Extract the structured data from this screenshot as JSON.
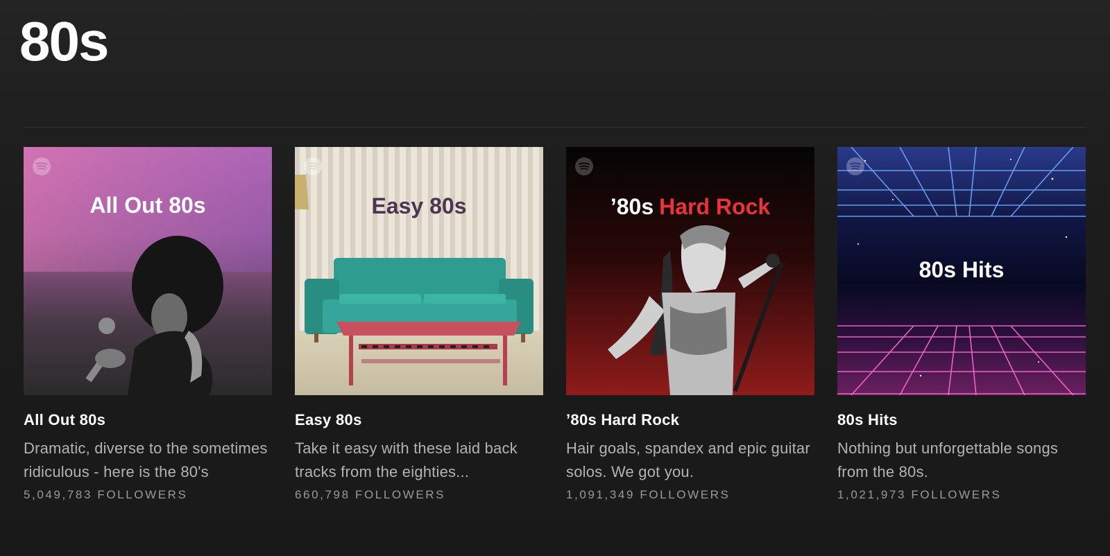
{
  "page": {
    "title": "80s"
  },
  "playlists": [
    {
      "cover_text": "All Out 80s",
      "title": "All Out 80s",
      "description": "Dramatic, diverse to the sometimes ridiculous - here is the 80's",
      "followers": "5,049,783 FOLLOWERS"
    },
    {
      "cover_text": "Easy 80s",
      "title": "Easy 80s",
      "description": "Take it easy with these laid back tracks from the eighties...",
      "followers": "660,798 FOLLOWERS"
    },
    {
      "cover_text_white": "’80s",
      "cover_text_red": "Hard Rock",
      "title": "’80s Hard Rock",
      "description": "Hair goals, spandex and epic guitar solos. We got you.",
      "followers": "1,091,349 FOLLOWERS"
    },
    {
      "cover_text": "80s Hits",
      "title": "80s Hits",
      "description": "Nothing but unforgettable songs from the 80s.",
      "followers": "1,021,973 FOLLOWERS"
    }
  ],
  "colors": {
    "background": "#1b1b1b",
    "secondary_text": "#b3b3b3",
    "hard_rock_red": "#e8343a"
  },
  "icons": [
    "spotify-icon"
  ]
}
